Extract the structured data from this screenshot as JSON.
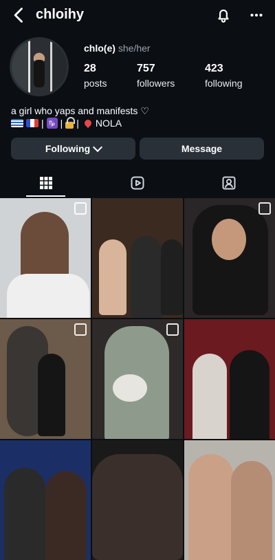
{
  "header": {
    "username": "chloihy"
  },
  "profile": {
    "display_name": "chlo(e)",
    "pronouns": "she/her",
    "stats": [
      {
        "value": "28",
        "label": "posts"
      },
      {
        "value": "757",
        "label": "followers"
      },
      {
        "value": "423",
        "label": "following"
      }
    ],
    "bio_line1": "a girl who yaps and manifests ♡",
    "bio_line2": {
      "sep": "|",
      "location": "NOLA",
      "zodiac_symbol": "♑"
    }
  },
  "actions": {
    "following_label": "Following",
    "message_label": "Message"
  },
  "tabs": [
    {
      "name": "grid",
      "icon": "grid-icon",
      "active": true
    },
    {
      "name": "reels",
      "icon": "reels-icon",
      "active": false
    },
    {
      "name": "tagged",
      "icon": "tagged-icon",
      "active": false
    }
  ],
  "grid": {
    "posts": [
      {
        "kind": "photo",
        "multi": true,
        "bg": "#cfd3d6",
        "accent": "#6b4c3a"
      },
      {
        "kind": "photo",
        "multi": false,
        "bg": "#3b2a20",
        "accent": "#caa17b"
      },
      {
        "kind": "photo",
        "multi": true,
        "bg": "#2a2526",
        "accent": "#8a5a49"
      },
      {
        "kind": "photo",
        "multi": true,
        "bg": "#6c5a4a",
        "accent": "#1b1b1b"
      },
      {
        "kind": "photo",
        "multi": true,
        "bg": "#2d2a29",
        "accent": "#8e9b8c"
      },
      {
        "kind": "photo",
        "multi": false,
        "bg": "#6b1a1f",
        "accent": "#d8d3cc"
      },
      {
        "kind": "photo",
        "multi": false,
        "bg": "#1b2f66",
        "accent": "#c69a7c"
      },
      {
        "kind": "photo",
        "multi": false,
        "bg": "#1a1a1a",
        "accent": "#3a2f2a"
      },
      {
        "kind": "photo",
        "multi": false,
        "bg": "#b7b4ae",
        "accent": "#caa187"
      }
    ]
  }
}
